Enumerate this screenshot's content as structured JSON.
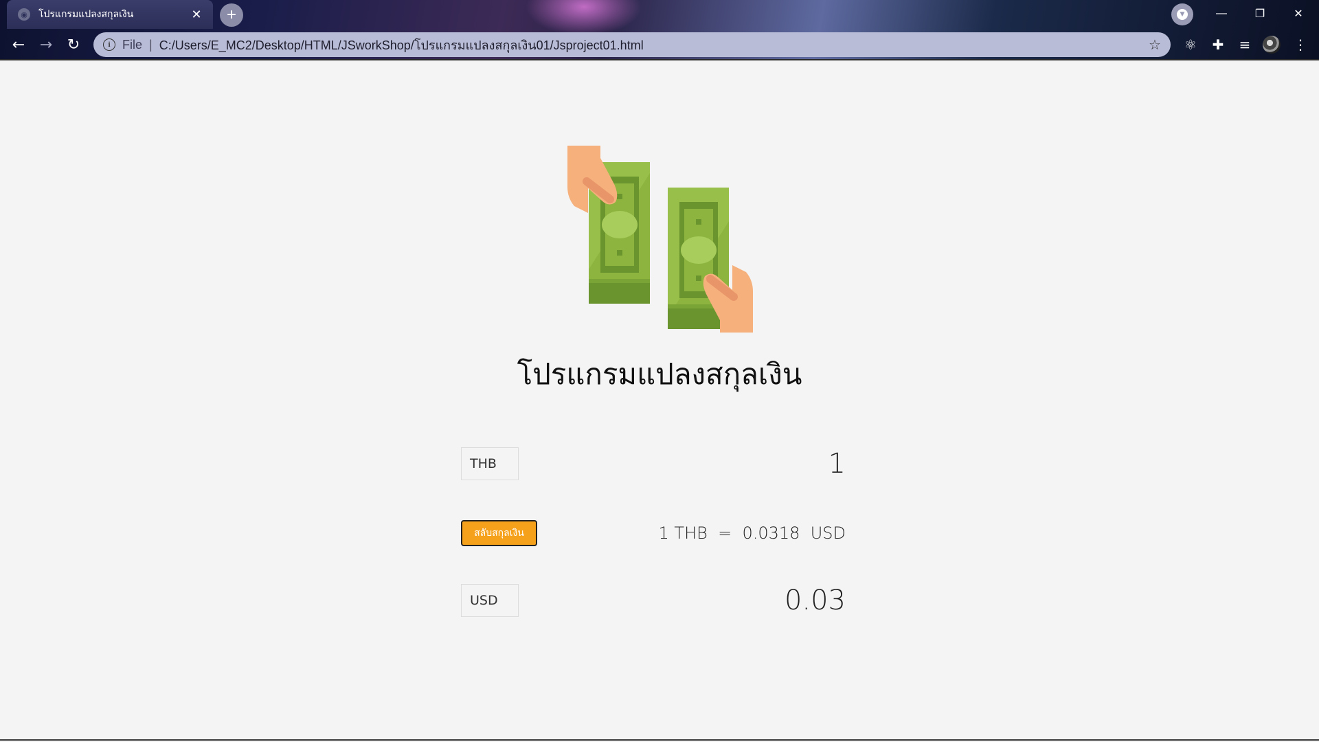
{
  "browser": {
    "tab_title": "โปรแกรมแปลงสกุลเงิน",
    "tab_close": "✕",
    "new_tab": "+",
    "window_controls": {
      "minimize": "—",
      "restore": "❐",
      "close": "✕"
    },
    "nav": {
      "back": "←",
      "forward": "→",
      "reload": "↻"
    },
    "address": {
      "info": "i",
      "scheme": "File",
      "separator": "|",
      "url": "C:/Users/E_MC2/Desktop/HTML/JSworkShop/โปรแกรมแปลงสกุลเงิน01/Jsproject01.html"
    },
    "icons": {
      "star": "☆",
      "react": "⚛",
      "extensions": "✚",
      "media": "≡",
      "menu": "⋮"
    }
  },
  "app": {
    "title": "โปรแกรมแปลงสกุลเงิน",
    "from": {
      "currency": "THB",
      "amount": "1"
    },
    "swap_label": "สลับสกุลเงิน",
    "rate_text": "1 THB  =  0.0318  USD",
    "to": {
      "currency": "USD",
      "amount": "0.03"
    },
    "colors": {
      "swap_button": "#f6a11c",
      "bill_green": "#8cb43f",
      "bill_dark": "#6a952e",
      "hand_skin": "#f5b07c"
    }
  }
}
